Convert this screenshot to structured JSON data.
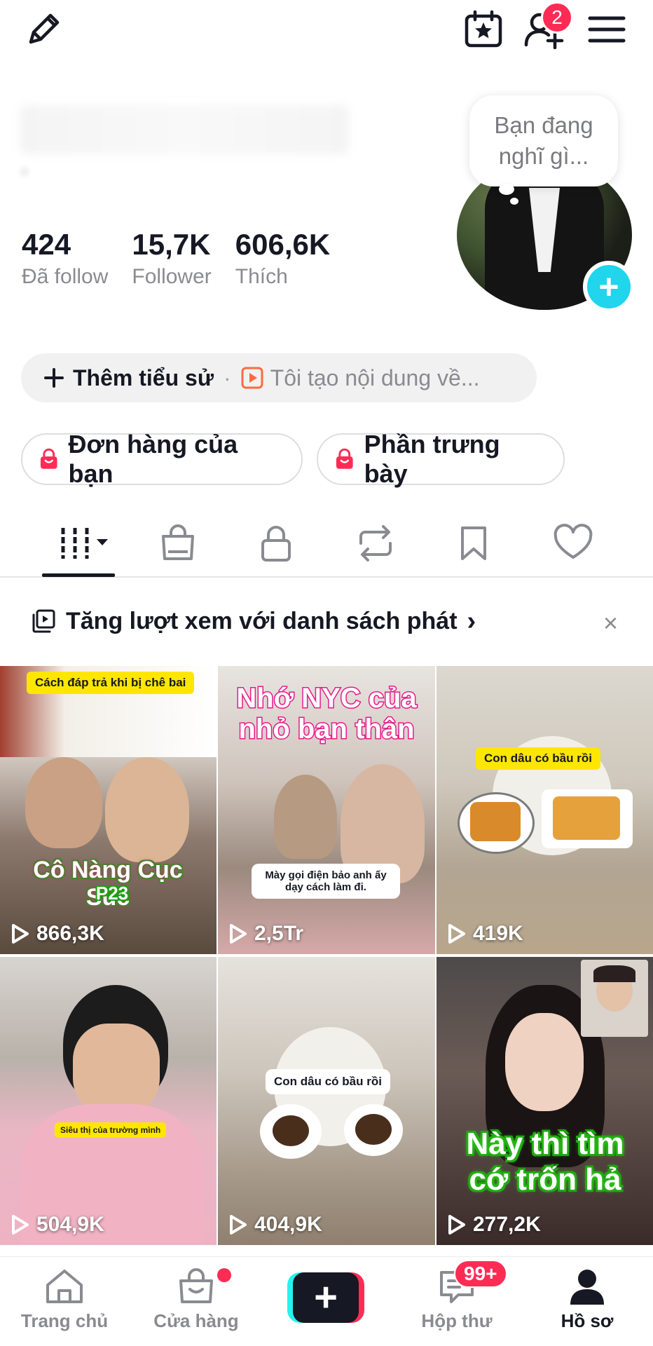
{
  "topbar": {
    "left_icon": "pencil-icon",
    "right_icons": [
      "calendar-star-icon",
      "add-friend-icon",
      "menu-icon"
    ],
    "friend_badge": "2"
  },
  "profile": {
    "stats": [
      {
        "value": "424",
        "label": "Đã follow"
      },
      {
        "value": "15,7K",
        "label": "Follower"
      },
      {
        "value": "606,6K",
        "label": "Thích"
      }
    ],
    "thought_bubble": "Bạn đang nghĩ gì...",
    "bio_add_label": "Thêm tiểu sử",
    "bio_separator": "·",
    "bio_hint": "Tôi tạo nội dung về..."
  },
  "shop_buttons": {
    "orders": "Đơn hàng của bạn",
    "showcase": "Phần trưng bày"
  },
  "tabs": [
    "videos-grid-icon",
    "shop-bag-icon",
    "lock-icon",
    "repost-icon",
    "bookmark-icon",
    "heart-icon"
  ],
  "banner": {
    "text": "Tăng lượt xem với danh sách phát",
    "chevron": "›",
    "close": "×"
  },
  "videos": [
    {
      "views": "866,3K",
      "caption_top": "Cách đáp trả khi bị chê bai",
      "caption_main": "Cô Nàng Cục Súc",
      "caption_sub": "P23"
    },
    {
      "views": "2,5Tr",
      "caption_main": "Nhớ NYC của nhỏ bạn thân",
      "caption_sub": "Mày gọi điện bảo anh ấy dạy cách làm đi."
    },
    {
      "views": "419K",
      "caption_top": "Con dâu có bầu rồi"
    },
    {
      "views": "504,9K",
      "caption_top": "Siêu thị của trường mình"
    },
    {
      "views": "404,9K",
      "caption_top": "Con dâu có bầu rồi"
    },
    {
      "views": "277,2K",
      "caption_main": "Này thì tìm cớ trốn hả"
    }
  ],
  "bottom_nav": {
    "home": "Trang chủ",
    "shop": "Cửa hàng",
    "create": "+",
    "inbox": "Hộp thư",
    "inbox_badge": "99+",
    "profile": "Hồ sơ"
  }
}
